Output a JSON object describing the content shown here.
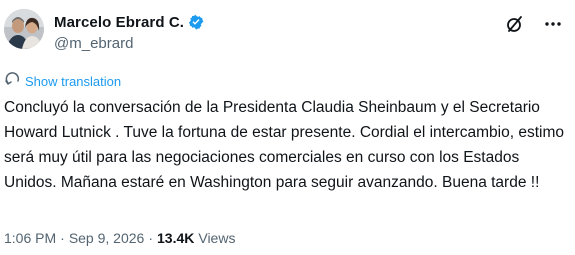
{
  "author": {
    "display_name": "Marcelo Ebrard C.",
    "handle": "@m_ebrard",
    "verified": true
  },
  "actions": {
    "grok_icon": "slash-circle-icon",
    "more_icon": "more-icon"
  },
  "translation": {
    "label": "Show translation",
    "icon": "translate-icon"
  },
  "tweet": {
    "text": "Concluyó la conversación de la Presidenta Claudia Sheinbaum y el Secretario Howard Lutnick . Tuve la fortuna de estar presente. Cordial el intercambio, estimo será muy útil para las negociaciones comerciales en curso con los Estados Unidos. Mañana estaré en Washington para seguir avanzando. Buena tarde !!"
  },
  "meta": {
    "time": "1:06 PM",
    "separator": "·",
    "date": "Sep 9, 2026",
    "views_count": "13.4K",
    "views_label": "Views"
  },
  "colors": {
    "accent": "#1d9bf0",
    "text": "#0f1419",
    "secondary": "#536471"
  }
}
